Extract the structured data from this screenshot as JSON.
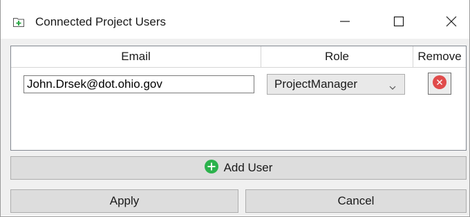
{
  "window": {
    "title": "Connected Project Users"
  },
  "grid": {
    "columns": [
      "Email",
      "Role",
      "Remove"
    ],
    "rows": [
      {
        "email": "John.Drsek@dot.ohio.gov",
        "role": "ProjectManager"
      }
    ]
  },
  "buttons": {
    "add_user": "Add User",
    "apply": "Apply",
    "cancel": "Cancel"
  },
  "icons": {
    "title": "add-folder-icon",
    "minimize": "minimize-icon",
    "maximize": "maximize-icon",
    "close": "close-icon",
    "dropdown": "chevron-down-icon",
    "remove": "remove-circle-icon",
    "add": "add-circle-icon"
  },
  "colors": {
    "remove_icon": "#e04b4b",
    "add_icon": "#2bb24c",
    "title_icon": "#2aa844"
  }
}
